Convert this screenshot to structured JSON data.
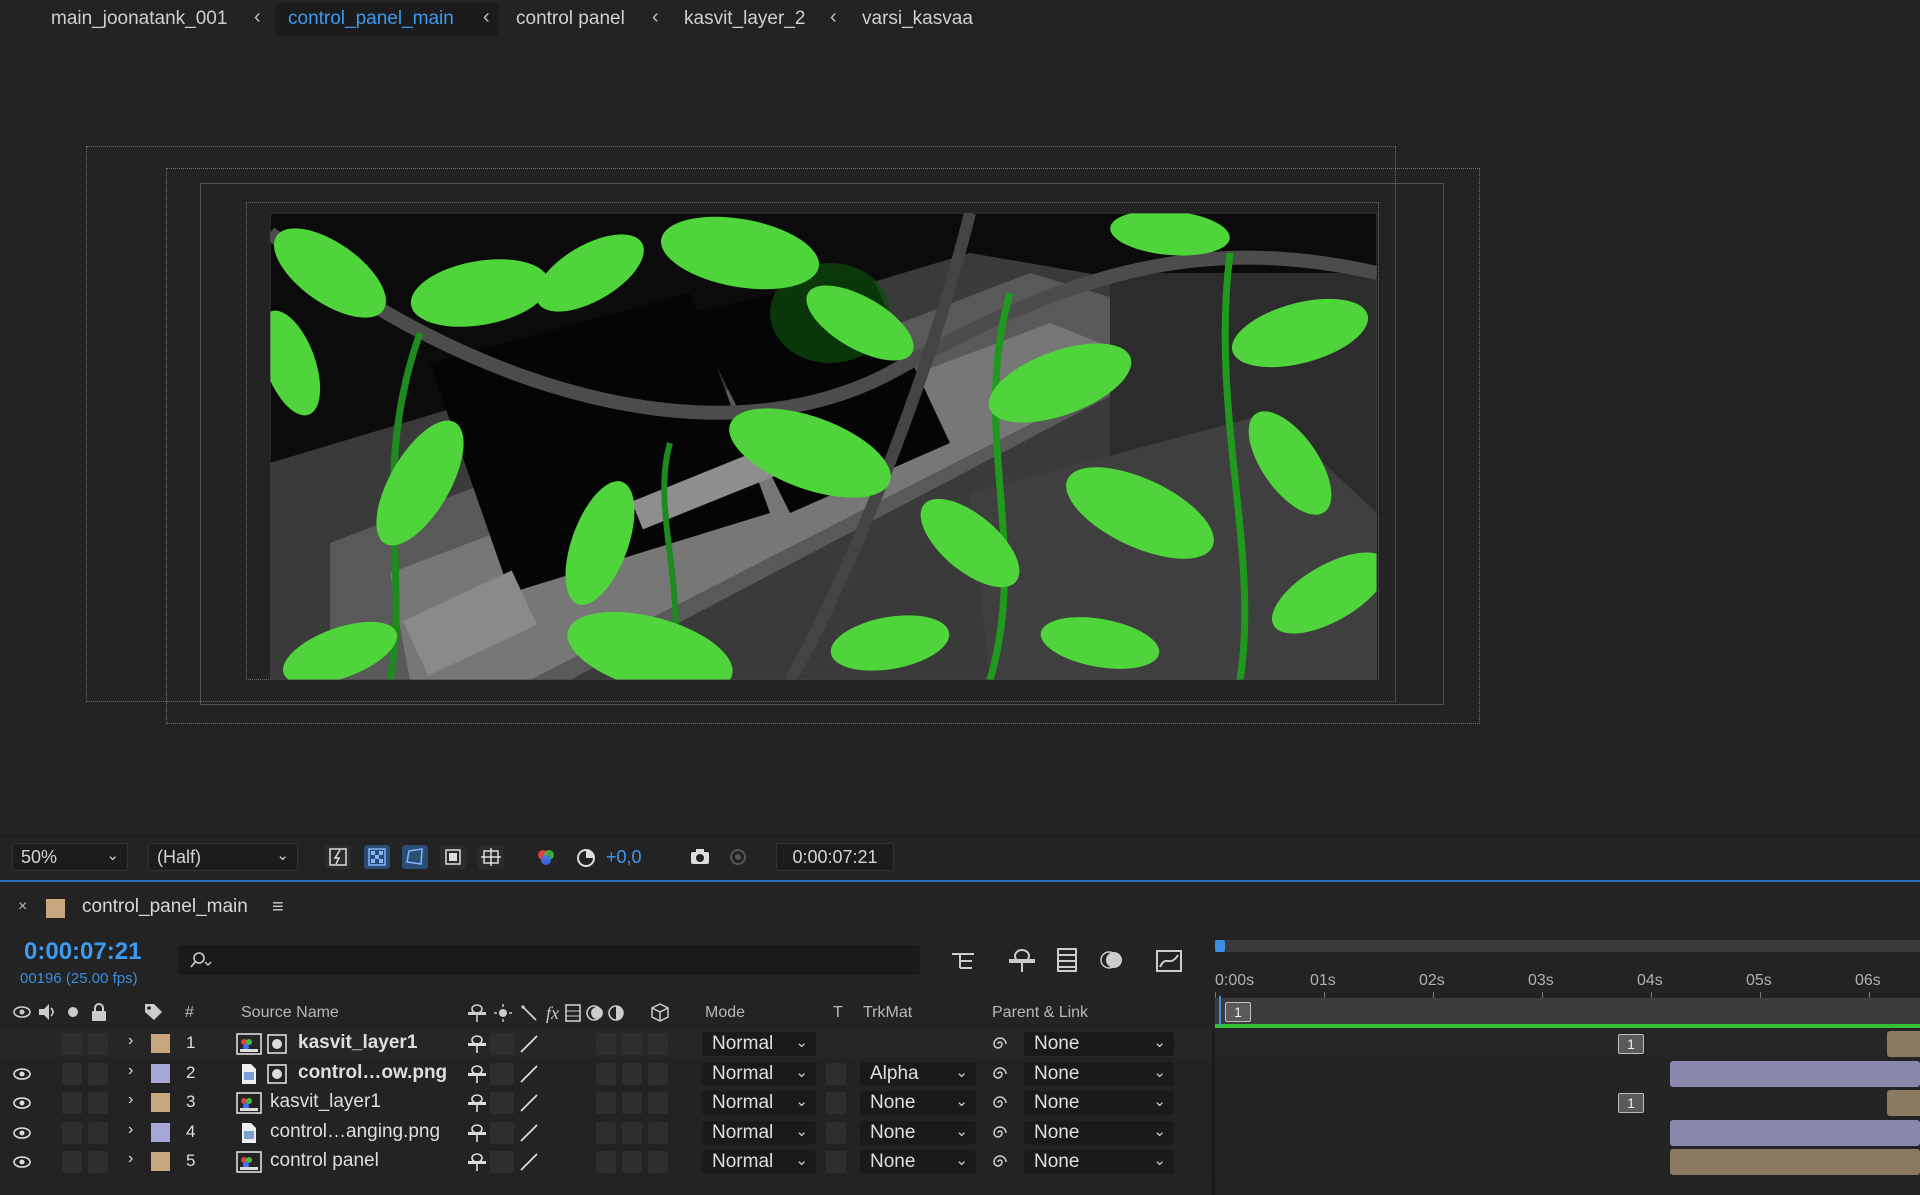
{
  "breadcrumb": {
    "items": [
      {
        "label": "main_joonatank_001"
      },
      {
        "label": "control_panel_main"
      },
      {
        "label": "control panel"
      },
      {
        "label": "kasvit_layer_2"
      },
      {
        "label": "varsi_kasvaa"
      }
    ],
    "separator": "‹"
  },
  "viewer": {
    "zoom": "50%",
    "resolution": "(Half)",
    "exposure": "+0,0",
    "current_time": "0:00:07:21"
  },
  "timeline": {
    "tab_label": "control_panel_main",
    "timecode": "0:00:07:21",
    "frame_info": "00196 (25.00 fps)",
    "columns": {
      "num": "#",
      "source_name": "Source Name",
      "mode": "Mode",
      "t": "T",
      "trkmat": "TrkMat",
      "parent": "Parent & Link"
    },
    "ruler_ticks": [
      "0:00s",
      "01s",
      "02s",
      "03s",
      "04s",
      "05s",
      "06s"
    ],
    "ruler_marker": "1",
    "layers": [
      {
        "num": "1",
        "name": "kasvit_layer1",
        "mode": "Normal",
        "trkmat": "",
        "parent": "None",
        "label_color": "#c8a77e",
        "keyframe": "1"
      },
      {
        "num": "2",
        "name": "control…ow.png",
        "mode": "Normal",
        "trkmat": "Alpha",
        "parent": "None",
        "label_color": "#a8a8d8",
        "keyframe": ""
      },
      {
        "num": "3",
        "name": "kasvit_layer1",
        "mode": "Normal",
        "trkmat": "None",
        "parent": "None",
        "label_color": "#c8a77e",
        "keyframe": "1"
      },
      {
        "num": "4",
        "name": "control…anging.png",
        "mode": "Normal",
        "trkmat": "None",
        "parent": "None",
        "label_color": "#a8a8d8",
        "keyframe": ""
      },
      {
        "num": "5",
        "name": "control panel",
        "mode": "Normal",
        "trkmat": "None",
        "parent": "None",
        "label_color": "#c8a77e",
        "keyframe": ""
      }
    ]
  },
  "colors": {
    "accent": "#3c9bf0",
    "panel_bg": "#232323",
    "work_area": "#33c233"
  }
}
